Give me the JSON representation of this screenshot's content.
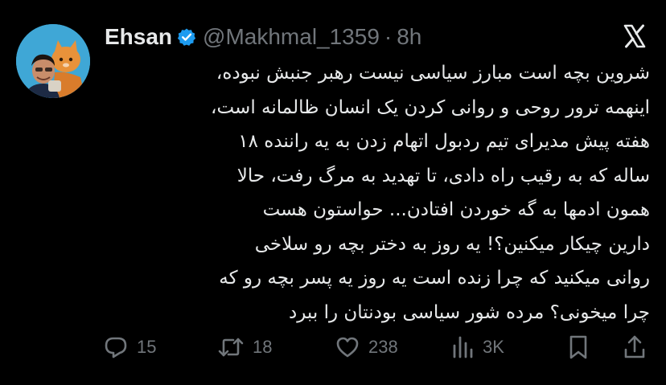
{
  "author": {
    "display_name": "Ehsan",
    "handle": "@Makhmal_1359",
    "separator": "·",
    "timestamp": "8h",
    "verified": true,
    "verified_color": "#1d9bf0"
  },
  "tweet": {
    "text": "شروین بچه است مبارز سیاسی نیست رهبر جنبش نبوده،\nاینهمه ترور روحی و روانی کردن یک انسان ظالمانه است،\nهفته پیش مدیرای تیم ردبول اتهام زدن به یه راننده ۱۸\nساله که به رقیب راه دادی، تا تهدید به مرگ رفت، حالا\nهمون ادمها به گه خوردن افتادن... حواستون هست\nدارین چیکار میکنین؟! یه روز به دختر بچه رو سلاخی\nروانی میکنید که چرا زنده است یه روز یه پسر بچه رو که\nچرا میخونی؟ مرده شور سیاسی بودنتان را ببرد"
  },
  "actions": {
    "replies": "15",
    "retweets": "18",
    "likes": "238",
    "views": "3K"
  },
  "icons": {
    "reply": "reply-icon",
    "retweet": "retweet-icon",
    "like": "heart-icon",
    "views": "views-chart-icon",
    "bookmark": "bookmark-icon",
    "share": "share-icon",
    "brand": "x-logo-icon",
    "verified": "verified-badge-icon"
  },
  "colors": {
    "background": "#000000",
    "text_primary": "#e7e9ea",
    "text_secondary": "#71767b",
    "accent": "#1d9bf0"
  }
}
